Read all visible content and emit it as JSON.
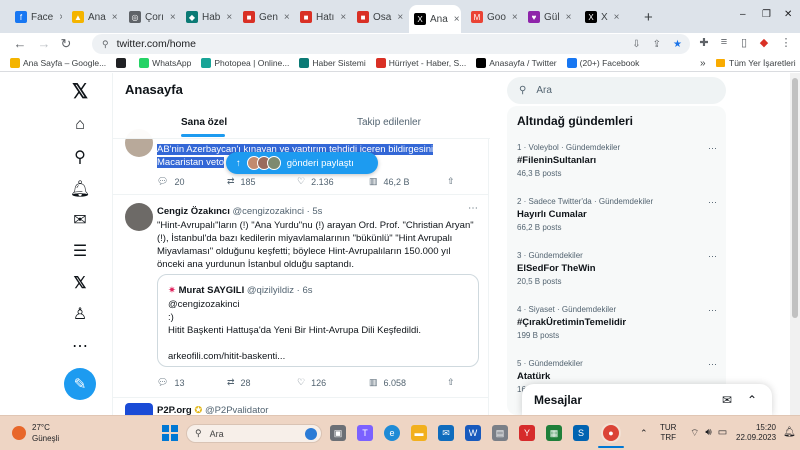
{
  "browser": {
    "tabs": [
      {
        "label": "Face",
        "icon": "facebook-icon",
        "color": "#1877f2",
        "glyph": "f"
      },
      {
        "label": "Ana",
        "icon": "google-drive-icon",
        "color": "#f4b400",
        "glyph": "▲"
      },
      {
        "label": "Çorı",
        "icon": "podcast-icon",
        "color": "#5f6368",
        "glyph": "◎"
      },
      {
        "label": "Hab",
        "icon": "news-icon",
        "color": "#0b7a75",
        "glyph": "◆"
      },
      {
        "label": "Gen",
        "icon": "red-icon",
        "color": "#d93025",
        "glyph": "■"
      },
      {
        "label": "Hatı",
        "icon": "red-icon",
        "color": "#d93025",
        "glyph": "■"
      },
      {
        "label": "Osa",
        "icon": "red-icon",
        "color": "#d93025",
        "glyph": "■"
      },
      {
        "label": "Ana",
        "icon": "x-icon",
        "color": "#000000",
        "glyph": "X"
      },
      {
        "label": "Goo",
        "icon": "gmail-icon",
        "color": "#ea4335",
        "glyph": "M"
      },
      {
        "label": "Gül",
        "icon": "purple-icon",
        "color": "#8e24aa",
        "glyph": "♥"
      },
      {
        "label": "X",
        "icon": "x-icon",
        "color": "#000000",
        "glyph": "X"
      }
    ],
    "new_tab": "+",
    "url": "twitter.com/home",
    "bookmarks": [
      {
        "label": "Ana Sayfa – Google...",
        "color": "#f4b400"
      },
      {
        "label": "",
        "color": "#202124"
      },
      {
        "label": "WhatsApp",
        "color": "#25d366"
      },
      {
        "label": "Photopea | Online...",
        "color": "#18a497"
      },
      {
        "label": "Haber Sistemi",
        "color": "#0b7a75"
      },
      {
        "label": "Hürriyet - Haber, S...",
        "color": "#d93025"
      },
      {
        "label": "Anasayfa / Twitter",
        "color": "#000000"
      },
      {
        "label": "(20+) Facebook",
        "color": "#1877f2"
      }
    ],
    "bookmarks_more": "»",
    "all_bookmarks": "Tüm Yer İşaretleri"
  },
  "twitter": {
    "page_title": "Anasayfa",
    "tabs": [
      "Sana özel",
      "Takip edilenler"
    ],
    "new_posts_pill": "gönderi paylaştı",
    "tweet1": {
      "line1": "AB'nin Azerbaycan'ı kınayan ve yaptırım tehdidi içeren bildirgesini",
      "line2": "Macaristan veto",
      "replies": "20",
      "retweets": "185",
      "likes": "2.136",
      "views": "46,2 B"
    },
    "tweet2": {
      "name": "Cengiz Özakıncı",
      "handle": "@cengizozakinci",
      "time": "· 5s",
      "lines": [
        "\"Hint-Avrupalı\"ların (!) \"Ana Yurdu\"nu (!) arayan Ord. Prof. \"Christian Aryan\"",
        "(!), İstanbul'da bazı kedilerin miyavlamalarının \"bükünlü\" \"Hint Avrupalı",
        "Miyavlaması\" olduğunu keşfetti; böylece Hint-Avrupalıların 150.000 yıl",
        "önceki ana yurdunun İstanbul olduğu saptandı."
      ],
      "quote": {
        "name": "Murat SAYGILI",
        "handle": "@qizilyildiz",
        "time": "· 6s",
        "lines": [
          "@cengizozakinci",
          ":)",
          "Hitit Başkenti Hattuşa'da Yeni Bir Hint-Avrupa Dili Keşfedildi."
        ],
        "link": "arkeofili.com/hitit-baskenti..."
      },
      "replies": "13",
      "retweets": "28",
      "likes": "126",
      "views": "6.058"
    },
    "tweet3": {
      "name": "P2P.org",
      "handle": "@P2Pvalidator"
    },
    "search_placeholder": "Ara",
    "trends_title": "Altındağ gündemleri",
    "trends": [
      {
        "meta": "1 · Voleybol · Gündemdekiler",
        "name": "#FileninSultanları",
        "count": "46,3 B posts"
      },
      {
        "meta": "2 · Sadece Twitter'da · Gündemdekiler",
        "name": "Hayırlı Cumalar",
        "count": "66,2 B posts"
      },
      {
        "meta": "3 · Gündemdekiler",
        "name": "ElSedFor TheWin",
        "count": "20,5 B posts"
      },
      {
        "meta": "4 · Siyaset · Gündemdekiler",
        "name": "#ÇırakÜretiminTemelidir",
        "count": "199 B posts"
      },
      {
        "meta": "5 · Gündemdekiler",
        "name": "Atatürk",
        "count": "16"
      }
    ],
    "messages_label": "Mesajlar"
  },
  "taskbar": {
    "weather_temp": "27°C",
    "weather_desc": "Güneşli",
    "search_placeholder": "Ara",
    "lang_line1": "TUR",
    "lang_line2": "TRF",
    "time": "15:20",
    "date": "22.09.2023"
  }
}
